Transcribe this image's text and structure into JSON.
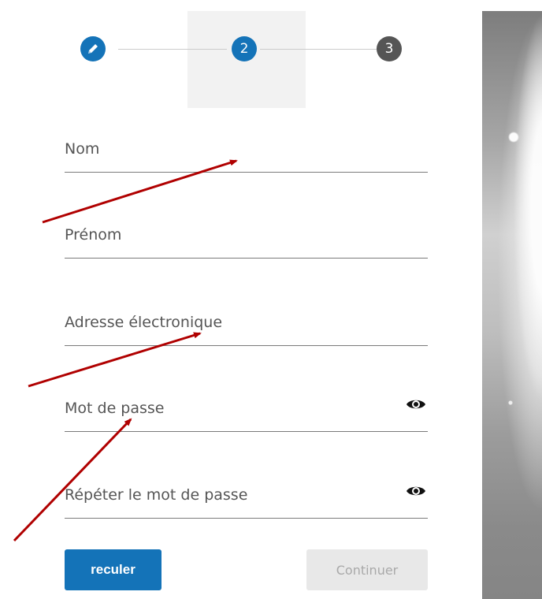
{
  "stepper": {
    "steps": [
      {
        "state": "completed",
        "icon": "pencil-icon",
        "label": ""
      },
      {
        "state": "active",
        "label": "2"
      },
      {
        "state": "pending",
        "label": "3"
      }
    ]
  },
  "form": {
    "fields": [
      {
        "label": "Nom"
      },
      {
        "label": "Prénom"
      },
      {
        "label": "Adresse électronique"
      },
      {
        "label": "Mot de passe",
        "icon": "eye-icon"
      },
      {
        "label": "Répéter le mot de passe",
        "icon": "eye-icon"
      }
    ]
  },
  "buttons": {
    "back_label": "reculer",
    "continue_label": "Continuer"
  },
  "colors": {
    "primary": "#1473b8",
    "step_pending": "#555555",
    "annotation_arrow": "#b00000",
    "disabled_button": "#e8e8e8"
  }
}
